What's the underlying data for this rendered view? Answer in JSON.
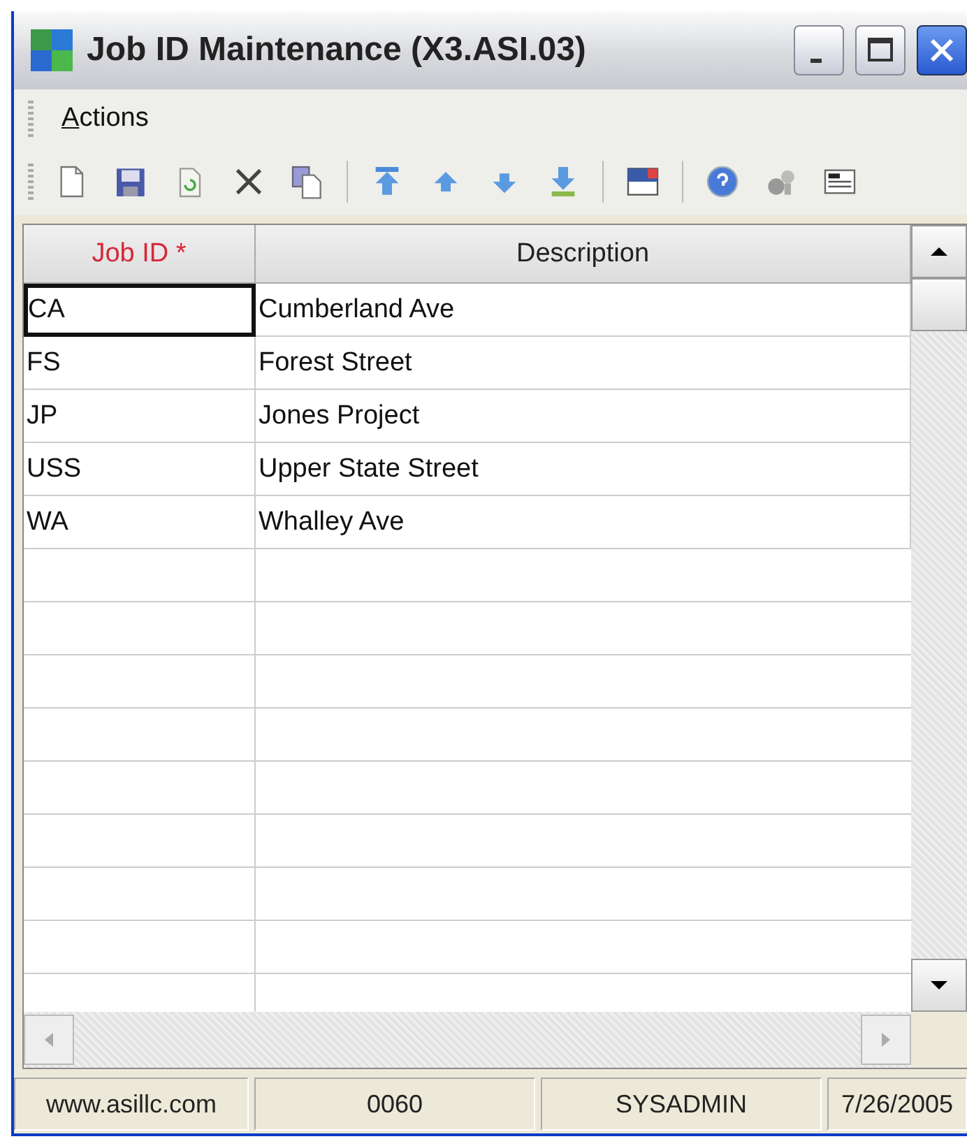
{
  "window": {
    "title": "Job ID Maintenance (X3.ASI.03)"
  },
  "menu": [
    {
      "label": "Actions"
    }
  ],
  "table": {
    "columns": [
      {
        "label": "Job ID *",
        "required": true
      },
      {
        "label": "Description",
        "required": false
      }
    ],
    "rows": [
      {
        "cells": [
          "CA",
          "Cumberland Ave"
        ],
        "selected": true
      },
      {
        "cells": [
          "FS",
          "Forest Street"
        ],
        "selected": false
      },
      {
        "cells": [
          "JP",
          "Jones Project"
        ],
        "selected": false
      },
      {
        "cells": [
          "USS",
          "Upper State Street"
        ],
        "selected": false
      },
      {
        "cells": [
          "WA",
          "Whalley Ave"
        ],
        "selected": false
      }
    ]
  },
  "status_bar": [
    "www.asillc.com",
    "0060",
    "SYSADMIN",
    "7/26/2005"
  ]
}
